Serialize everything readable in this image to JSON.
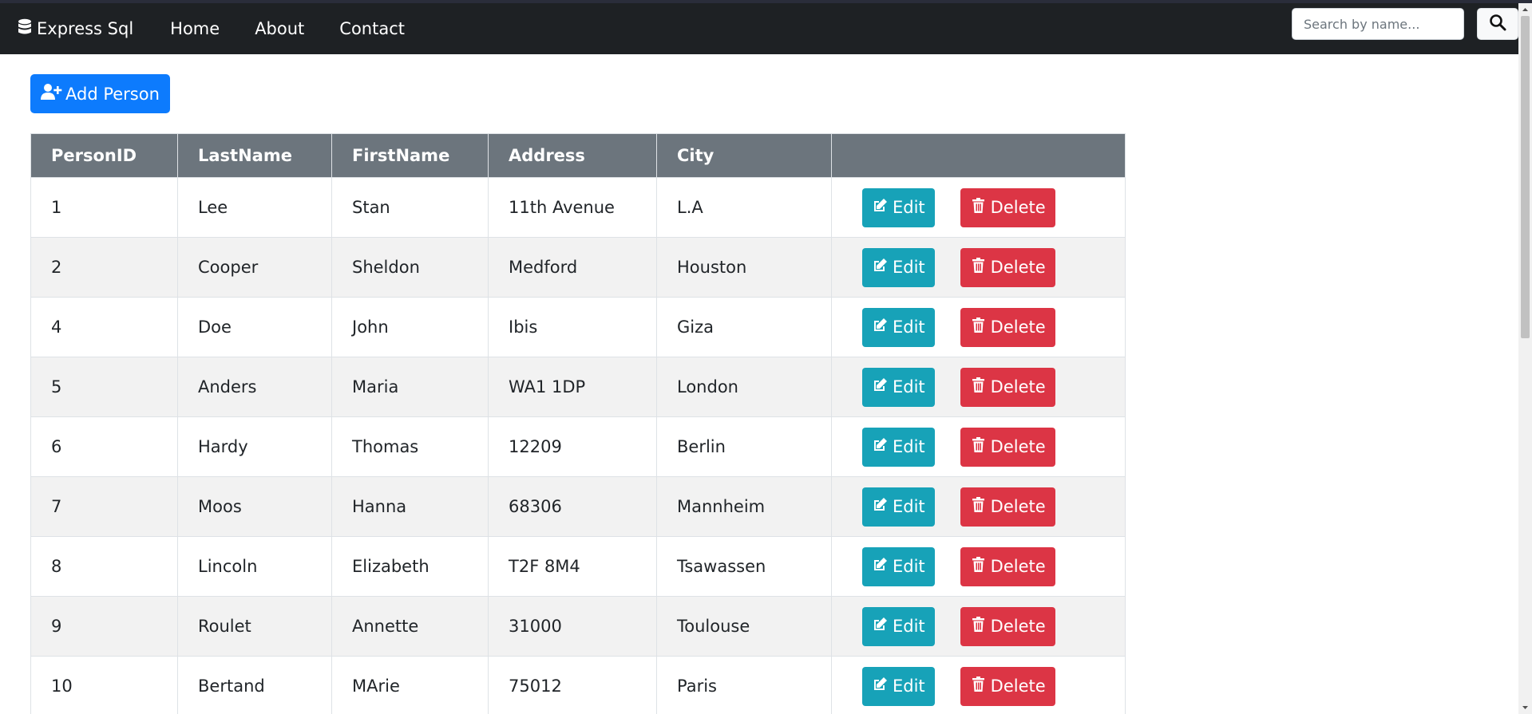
{
  "navbar": {
    "brand": "Express Sql",
    "brand_icon": "database-icon",
    "links": [
      "Home",
      "About",
      "Contact"
    ],
    "search_placeholder": "Search by name...",
    "search_icon": "search-icon"
  },
  "add_button": {
    "label": "Add Person",
    "icon": "user-plus-icon"
  },
  "table": {
    "headers": [
      "PersonID",
      "LastName",
      "FirstName",
      "Address",
      "City",
      ""
    ],
    "rows": [
      {
        "id": "1",
        "last": "Lee",
        "first": "Stan",
        "address": "11th Avenue",
        "city": "L.A"
      },
      {
        "id": "2",
        "last": "Cooper",
        "first": "Sheldon",
        "address": "Medford",
        "city": "Houston"
      },
      {
        "id": "4",
        "last": "Doe",
        "first": "John",
        "address": "Ibis",
        "city": "Giza"
      },
      {
        "id": "5",
        "last": "Anders",
        "first": "Maria",
        "address": "WA1 1DP",
        "city": "London"
      },
      {
        "id": "6",
        "last": "Hardy",
        "first": "Thomas",
        "address": "12209",
        "city": "Berlin"
      },
      {
        "id": "7",
        "last": "Moos",
        "first": "Hanna",
        "address": "68306",
        "city": "Mannheim"
      },
      {
        "id": "8",
        "last": "Lincoln",
        "first": "Elizabeth",
        "address": "T2F 8M4",
        "city": "Tsawassen"
      },
      {
        "id": "9",
        "last": "Roulet",
        "first": "Annette",
        "address": "31000",
        "city": "Toulouse"
      },
      {
        "id": "10",
        "last": "Bertand",
        "first": "MArie",
        "address": "75012",
        "city": "Paris"
      }
    ],
    "edit_label": "Edit",
    "delete_label": "Delete",
    "edit_icon": "edit-icon",
    "delete_icon": "trash-icon"
  },
  "colors": {
    "navbar_bg": "#1e2124",
    "primary": "#0d7bfd",
    "info": "#17a2b8",
    "danger": "#dc3545",
    "table_header": "#6c757d"
  }
}
